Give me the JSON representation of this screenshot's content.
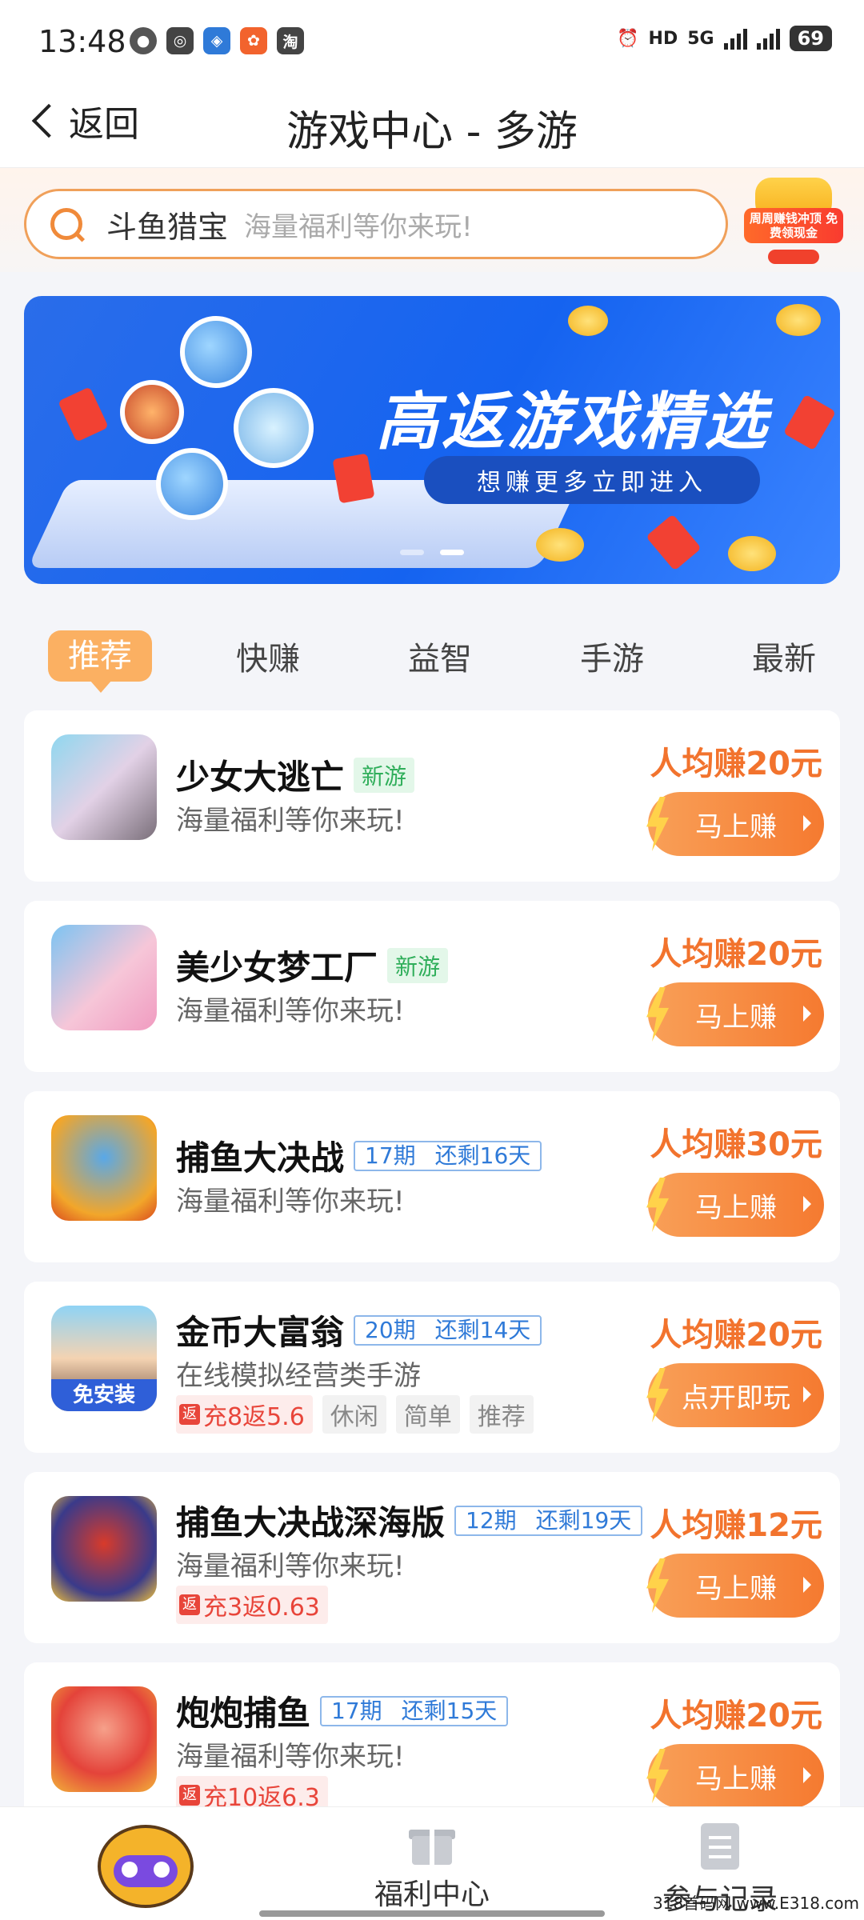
{
  "status_bar": {
    "time": "13:48",
    "network": "5G",
    "battery": "69",
    "apps": [
      "wechat-icon",
      "qq-icon",
      "weibo-icon",
      "xiaohongshu-icon",
      "taobao-icon"
    ]
  },
  "header": {
    "back_label": "返回",
    "title": "游戏中心 - 多游"
  },
  "search": {
    "keyword": "斗鱼猎宝",
    "placeholder": "海量福利等你来玩!",
    "promo_text": "周周赚钱冲顶 免费领现金"
  },
  "banner": {
    "title": "高返游戏精选",
    "subtitle": "想赚更多立即进入"
  },
  "tabs": [
    "推荐",
    "快赚",
    "益智",
    "手游",
    "最新"
  ],
  "games": [
    {
      "name": "少女大逃亡",
      "tag_new": "新游",
      "desc": "海量福利等你来玩!",
      "earn": "人均赚20元",
      "button": "马上赚"
    },
    {
      "name": "美少女梦工厂",
      "tag_new": "新游",
      "desc": "海量福利等你来玩!",
      "earn": "人均赚20元",
      "button": "马上赚"
    },
    {
      "name": "捕鱼大决战",
      "period": "17期",
      "remaining": "还剩16天",
      "desc": "海量福利等你来玩!",
      "earn": "人均赚30元",
      "button": "马上赚"
    },
    {
      "name": "金币大富翁",
      "period": "20期",
      "remaining": "还剩14天",
      "desc": "在线模拟经营类手游",
      "fan_icon": "返",
      "fan": "充8返5.6",
      "tags": [
        "休闲",
        "简单",
        "推荐"
      ],
      "earn": "人均赚20元",
      "button": "点开即玩",
      "badge": "免安装"
    },
    {
      "name": "捕鱼大决战深海版",
      "period": "12期",
      "remaining": "还剩19天",
      "desc": "海量福利等你来玩!",
      "fan_icon": "返",
      "fan": "充3返0.63",
      "earn": "人均赚12元",
      "button": "马上赚"
    },
    {
      "name": "炮炮捕鱼",
      "period": "17期",
      "remaining": "还剩15天",
      "desc": "海量福利等你来玩!",
      "fan_icon": "返",
      "fan": "充10返6.3",
      "earn": "人均赚20元",
      "button": "马上赚"
    }
  ],
  "bottom_nav": {
    "welfare": "福利中心",
    "records": "参与记录"
  },
  "watermark": "318首码网 www.E318.com"
}
